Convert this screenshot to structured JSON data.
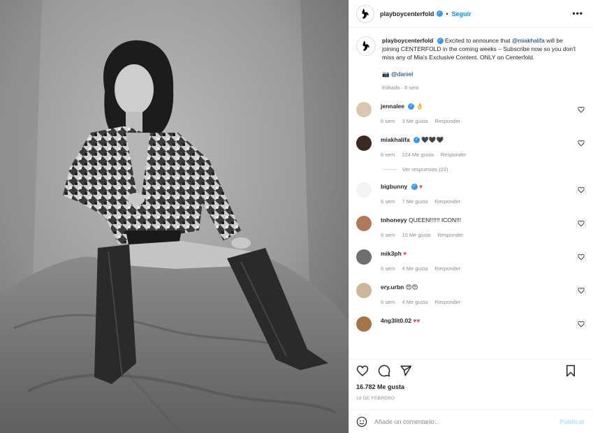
{
  "post": {
    "account": "playboycenterfold",
    "follow_label": "Seguir",
    "separator": "•"
  },
  "caption": {
    "username": "playboycenterfold",
    "text_1": "Excited to announce that ",
    "mention_1": "@miakhalifa",
    "text_2": " will be joining CENTERFOLD in the coming weeks – Subscribe now so you don't miss any of Mia's Exclusive Content. ONLY on Centerfold.",
    "credit_prefix": "📷",
    "mention_2": "@daniel",
    "meta": "Editado · 6 sem"
  },
  "comments": [
    {
      "username": "jennalee",
      "verified": true,
      "text": "👌",
      "age": "6 sem",
      "likes": "3 Me gusta",
      "reply": "Responder",
      "avatar_color": "#d9c7b0"
    },
    {
      "username": "miakhalifa",
      "verified": true,
      "text": "🖤🖤🖤",
      "age": "6 sem",
      "likes": "224 Me gusta",
      "reply": "Responder",
      "avatar_color": "#3a2a24",
      "view_replies": "Ver respuestas (22)"
    },
    {
      "username": "bigbunny",
      "verified": true,
      "text": "♥",
      "age": "6 sem",
      "likes": "7 Me gusta",
      "reply": "Responder",
      "avatar_color": "#f3f3f3"
    },
    {
      "username": "tnhoneyy",
      "verified": false,
      "text": "QUEEN!!!!!! ICON!!!",
      "age": "6 sem",
      "likes": "10 Me gusta",
      "reply": "Responder",
      "avatar_color": "#b07a58"
    },
    {
      "username": "mik3ph",
      "verified": false,
      "text": "♥",
      "age": "6 sem",
      "likes": "4 Me gusta",
      "reply": "Responder",
      "avatar_color": "#6f6f6f"
    },
    {
      "username": "ery.urbn",
      "verified": false,
      "text": "😍😍",
      "age": "6 sem",
      "likes": "4 Me gusta",
      "reply": "Responder",
      "avatar_color": "#cbb89c"
    },
    {
      "username": "4ng3lit0.02",
      "verified": false,
      "text": "♥♥",
      "age": "",
      "likes": "",
      "reply": "",
      "avatar_color": "#a57548"
    }
  ],
  "likes": "16.782 Me gusta",
  "date": "18 DE FEBRERO",
  "add_comment": {
    "placeholder": "Añade un comentario...",
    "publish": "Publicar"
  },
  "colors": {
    "link": "#00376b",
    "accent": "#0095f6",
    "heart": "#ed4956",
    "muted": "#8e8e8e"
  },
  "icons": [
    "playboy-logo-icon",
    "verified-icon",
    "more-icon",
    "heart-icon",
    "comment-icon",
    "share-icon",
    "save-icon",
    "emoji-icon"
  ]
}
